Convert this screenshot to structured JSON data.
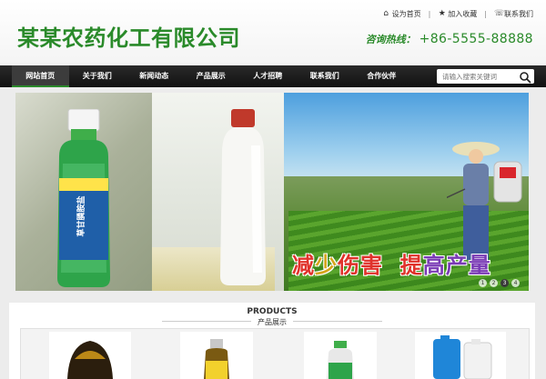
{
  "header": {
    "company_name": "某某农药化工有限公司",
    "top_links": [
      {
        "label": "设为首页",
        "icon": "home-icon"
      },
      {
        "label": "加入收藏",
        "icon": "star-icon"
      },
      {
        "label": "联系我们",
        "icon": "phone-icon"
      }
    ],
    "hotline_label": "咨询热线：",
    "hotline_number": "+86-5555-88888"
  },
  "nav": {
    "items": [
      "网站首页",
      "关于我们",
      "新闻动态",
      "产品展示",
      "人才招聘",
      "联系我们",
      "合作伙伴"
    ],
    "active_index": 0
  },
  "search": {
    "placeholder": "请输入搜索关键词",
    "icon": "search-icon"
  },
  "banner": {
    "slogan_parts": [
      {
        "text": "减",
        "color": "#e0322b"
      },
      {
        "text": "少",
        "color": "#d6a41a"
      },
      {
        "text": "伤害",
        "color": "#e0322b"
      },
      {
        "text": "  ",
        "color": "#000"
      },
      {
        "text": "提",
        "color": "#e0322b"
      },
      {
        "text": "高",
        "color": "#7a3bb5"
      },
      {
        "text": "产量",
        "color": "#7a3bb5"
      }
    ],
    "bottle_label": "草甘膦胺盐",
    "slide_dots": [
      "1",
      "2",
      "3",
      "4"
    ],
    "active_slide": 2
  },
  "products": {
    "title_en": "PRODUCTS",
    "title_cn": "产品展示"
  },
  "colors": {
    "brand_green": "#2a8a2a",
    "nav_bg": "#1c1c1c"
  }
}
